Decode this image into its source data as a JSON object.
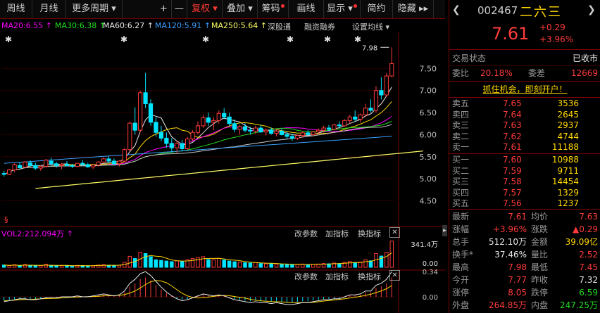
{
  "toolbar": {
    "items": [
      {
        "label": "周线"
      },
      {
        "label": "月线"
      },
      {
        "label": "更多周期 ▾"
      },
      {
        "label": "+"
      },
      {
        "label": "—"
      },
      {
        "label": "复权 ▾"
      },
      {
        "label": "叠加 ▾"
      },
      {
        "label": "筹码"
      },
      {
        "label": "画线"
      },
      {
        "label": "显示 ▾"
      },
      {
        "label": "简约"
      },
      {
        "label": "隐藏 ▸▸"
      }
    ]
  },
  "ma_legend": {
    "ma20": "MA20:6.55",
    "ma30": "MA30:6.38",
    "ma60": "MA60:6.27",
    "ma120": "MA120:5.91",
    "ma250": "MA250:5.64",
    "btn_sgt": "深股通",
    "btn_rzrq": "融资融券",
    "btn_setma": "设置均线 ▾"
  },
  "colors": {
    "up": "#ff3b3b",
    "down": "#00e5ff",
    "ma5": "#e8e8e8",
    "ma10": "#ffd700",
    "ma20": "#ff00ff",
    "ma30": "#22dd22",
    "ma60": "#c8c8c8",
    "ma120": "#3aa0ff",
    "ma250": "#ffff66"
  },
  "chart_data": [
    {
      "type": "candlestick",
      "title": "",
      "ylim": [
        4.3,
        8.0
      ],
      "yticks": [
        "7.50",
        "7.00",
        "6.50",
        "6.00",
        "5.50",
        "5.00",
        "4.50"
      ],
      "last_high_label": "7.98",
      "candles": [
        [
          5.12,
          5.18,
          5.05,
          5.1
        ],
        [
          5.1,
          5.22,
          5.08,
          5.2
        ],
        [
          5.2,
          5.35,
          5.15,
          5.32
        ],
        [
          5.3,
          5.38,
          5.22,
          5.25
        ],
        [
          5.26,
          5.4,
          5.24,
          5.38
        ],
        [
          5.36,
          5.42,
          5.28,
          5.3
        ],
        [
          5.3,
          5.36,
          5.2,
          5.24
        ],
        [
          5.24,
          5.3,
          5.18,
          5.28
        ],
        [
          5.28,
          5.45,
          5.26,
          5.42
        ],
        [
          5.4,
          5.48,
          5.3,
          5.34
        ],
        [
          5.34,
          5.38,
          5.25,
          5.3
        ],
        [
          5.3,
          5.36,
          5.22,
          5.33
        ],
        [
          5.33,
          5.4,
          5.28,
          5.3
        ],
        [
          5.3,
          5.34,
          5.24,
          5.28
        ],
        [
          5.28,
          5.36,
          5.26,
          5.35
        ],
        [
          5.35,
          5.42,
          5.3,
          5.32
        ],
        [
          5.32,
          5.36,
          5.25,
          5.27
        ],
        [
          5.27,
          5.33,
          5.22,
          5.31
        ],
        [
          5.31,
          5.4,
          5.28,
          5.38
        ],
        [
          5.38,
          5.48,
          5.34,
          5.45
        ],
        [
          5.45,
          5.52,
          5.36,
          5.4
        ],
        [
          5.4,
          5.46,
          5.3,
          5.34
        ],
        [
          5.34,
          5.42,
          5.28,
          5.4
        ],
        [
          5.4,
          5.7,
          5.38,
          5.66
        ],
        [
          5.66,
          6.3,
          5.62,
          6.26
        ],
        [
          6.26,
          6.62,
          6.0,
          6.1
        ],
        [
          6.1,
          7.0,
          6.05,
          6.95
        ],
        [
          6.95,
          7.4,
          6.6,
          6.7
        ],
        [
          6.7,
          6.8,
          6.2,
          6.28
        ],
        [
          6.28,
          6.4,
          5.95,
          6.05
        ],
        [
          6.05,
          6.2,
          5.85,
          5.92
        ],
        [
          5.92,
          6.05,
          5.7,
          5.8
        ],
        [
          5.8,
          5.92,
          5.6,
          5.7
        ],
        [
          5.7,
          5.86,
          5.58,
          5.8
        ],
        [
          5.8,
          5.88,
          5.62,
          5.68
        ],
        [
          5.68,
          5.95,
          5.65,
          5.9
        ],
        [
          5.9,
          6.1,
          5.86,
          6.05
        ],
        [
          6.05,
          6.3,
          6.0,
          6.2
        ],
        [
          6.2,
          6.45,
          6.15,
          6.38
        ],
        [
          6.38,
          6.5,
          6.2,
          6.28
        ],
        [
          6.28,
          6.4,
          6.1,
          6.32
        ],
        [
          6.32,
          6.55,
          6.25,
          6.48
        ],
        [
          6.48,
          6.6,
          6.35,
          6.4
        ],
        [
          6.4,
          6.5,
          6.2,
          6.25
        ],
        [
          6.25,
          6.35,
          6.05,
          6.12
        ],
        [
          6.12,
          6.22,
          6.0,
          6.18
        ],
        [
          6.18,
          6.26,
          6.05,
          6.1
        ],
        [
          6.1,
          6.18,
          6.0,
          6.08
        ],
        [
          6.08,
          6.2,
          6.02,
          6.15
        ],
        [
          6.15,
          6.22,
          6.04,
          6.06
        ],
        [
          6.06,
          6.14,
          5.98,
          6.1
        ],
        [
          6.1,
          6.16,
          6.0,
          6.03
        ],
        [
          6.03,
          6.12,
          5.96,
          6.08
        ],
        [
          6.08,
          6.14,
          5.98,
          6.0
        ],
        [
          6.0,
          6.06,
          5.9,
          5.96
        ],
        [
          5.96,
          6.02,
          5.86,
          5.92
        ],
        [
          5.92,
          6.0,
          5.88,
          5.98
        ],
        [
          5.98,
          6.08,
          5.94,
          6.04
        ],
        [
          6.04,
          6.1,
          5.98,
          6.0
        ],
        [
          6.0,
          6.08,
          5.96,
          6.06
        ],
        [
          6.06,
          6.14,
          6.02,
          6.1
        ],
        [
          6.1,
          6.2,
          6.05,
          6.15
        ],
        [
          6.15,
          6.22,
          6.08,
          6.12
        ],
        [
          6.12,
          6.25,
          6.1,
          6.22
        ],
        [
          6.22,
          6.3,
          6.15,
          6.2
        ],
        [
          6.2,
          6.35,
          6.18,
          6.32
        ],
        [
          6.32,
          6.45,
          6.25,
          6.4
        ],
        [
          6.4,
          6.55,
          6.3,
          6.35
        ],
        [
          6.35,
          6.48,
          6.28,
          6.45
        ],
        [
          6.45,
          6.7,
          6.4,
          6.6
        ],
        [
          6.6,
          6.8,
          6.5,
          6.55
        ],
        [
          6.55,
          7.1,
          6.5,
          7.0
        ],
        [
          7.0,
          7.3,
          6.8,
          6.9
        ],
        [
          6.9,
          7.4,
          6.85,
          7.33
        ],
        [
          7.33,
          7.98,
          7.3,
          7.61
        ]
      ],
      "indicator_label": "VOL2:212.094万",
      "volume": [
        18,
        14,
        20,
        12,
        22,
        16,
        12,
        14,
        24,
        15,
        12,
        14,
        13,
        12,
        15,
        14,
        12,
        13,
        18,
        22,
        16,
        13,
        16,
        40,
        88,
        70,
        120,
        110,
        85,
        60,
        55,
        50,
        45,
        52,
        48,
        60,
        70,
        78,
        85,
        62,
        60,
        72,
        58,
        50,
        44,
        40,
        36,
        34,
        38,
        30,
        28,
        30,
        26,
        24,
        22,
        20,
        24,
        26,
        22,
        24,
        26,
        30,
        28,
        34,
        30,
        40,
        46,
        38,
        42,
        60,
        52,
        110,
        90,
        120,
        210
      ],
      "volume_ticks": [
        "341.4万",
        "0.00"
      ],
      "macd_ticks": [
        "0.34",
        "0.00",
        "-0.34"
      ],
      "macd": [
        -0.05,
        -0.04,
        -0.03,
        -0.02,
        -0.02,
        -0.03,
        -0.03,
        -0.02,
        -0.01,
        -0.01,
        -0.01,
        0.0,
        0.0,
        0.0,
        0.01,
        0.0,
        0.0,
        0.01,
        0.02,
        0.03,
        0.02,
        0.01,
        0.02,
        0.06,
        0.14,
        0.18,
        0.24,
        0.26,
        0.22,
        0.16,
        0.1,
        0.05,
        0.01,
        -0.02,
        -0.04,
        -0.03,
        -0.01,
        0.01,
        0.03,
        0.02,
        0.01,
        0.02,
        0.01,
        -0.01,
        -0.03,
        -0.04,
        -0.05,
        -0.06,
        -0.05,
        -0.06,
        -0.06,
        -0.07,
        -0.06,
        -0.07,
        -0.08,
        -0.08,
        -0.07,
        -0.06,
        -0.06,
        -0.05,
        -0.04,
        -0.03,
        -0.03,
        -0.02,
        -0.02,
        0.0,
        0.02,
        0.02,
        0.03,
        0.06,
        0.06,
        0.12,
        0.14,
        0.18,
        0.26
      ]
    }
  ],
  "panel_labels": {
    "indicator_params": "改参数",
    "add_indicator": "加指标",
    "switch_indicator": "换指标",
    "close": "✕"
  },
  "right_panel": {
    "code": "002467",
    "name": "二六三",
    "price": "7.61",
    "change": "+0.29",
    "pct": "+3.96%",
    "trade_status_label": "交易状态",
    "trade_status": "已收市",
    "weibi_label": "委比",
    "weibi": "20.18%",
    "weicha_label": "委差",
    "weicha": "12669",
    "promo": "抓住机会，即刻开户！",
    "asks": [
      {
        "label": "卖五",
        "price": "7.65",
        "vol": "3536"
      },
      {
        "label": "卖四",
        "price": "7.64",
        "vol": "2645"
      },
      {
        "label": "卖三",
        "price": "7.63",
        "vol": "2937"
      },
      {
        "label": "卖二",
        "price": "7.62",
        "vol": "4744"
      },
      {
        "label": "卖一",
        "price": "7.61",
        "vol": "11188"
      }
    ],
    "bids": [
      {
        "label": "买一",
        "price": "7.60",
        "vol": "10988"
      },
      {
        "label": "买二",
        "price": "7.59",
        "vol": "9711"
      },
      {
        "label": "买三",
        "price": "7.58",
        "vol": "14454"
      },
      {
        "label": "买四",
        "price": "7.57",
        "vol": "1329"
      },
      {
        "label": "买五",
        "price": "7.56",
        "vol": "1237"
      }
    ],
    "stats": [
      {
        "l1": "最新",
        "v1": "7.61",
        "c1": "red",
        "l2": "均价",
        "v2": "7.63",
        "c2": "red"
      },
      {
        "l1": "涨幅",
        "v1": "+3.96%",
        "c1": "red",
        "l2": "涨跌",
        "v2": "▲0.29",
        "c2": "red"
      },
      {
        "l1": "总手",
        "v1": "512.10万",
        "c1": "white",
        "l2": "金额",
        "v2": "39.09亿",
        "c2": "yellow"
      },
      {
        "l1": "换手*",
        "v1": "37.46%",
        "c1": "white",
        "l2": "量比",
        "v2": "2.52",
        "c2": "red"
      },
      {
        "l1": "最高",
        "v1": "7.98",
        "c1": "red",
        "l2": "最低",
        "v2": "7.45",
        "c2": "red"
      },
      {
        "l1": "今开",
        "v1": "7.77",
        "c1": "red",
        "l2": "昨收",
        "v2": "7.32",
        "c2": "white"
      },
      {
        "l1": "涨停",
        "v1": "8.05",
        "c1": "red",
        "l2": "跌停",
        "v2": "6.59",
        "c2": "green"
      },
      {
        "l1": "外盘",
        "v1": "264.85万",
        "c1": "red",
        "l2": "内盘",
        "v2": "247.25万",
        "c2": "green"
      }
    ]
  }
}
